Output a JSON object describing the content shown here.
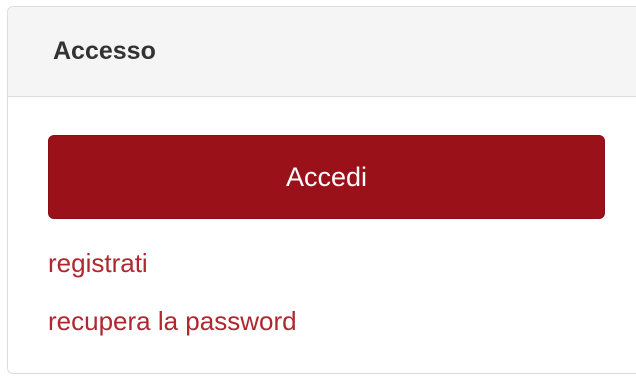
{
  "panel": {
    "title": "Accesso",
    "login_button_label": "Accedi",
    "links": [
      {
        "label": "registrati"
      },
      {
        "label": "recupera la password"
      }
    ]
  },
  "colors": {
    "accent": "#9a111a",
    "link": "#b0272f",
    "header_bg": "#f5f5f5"
  }
}
